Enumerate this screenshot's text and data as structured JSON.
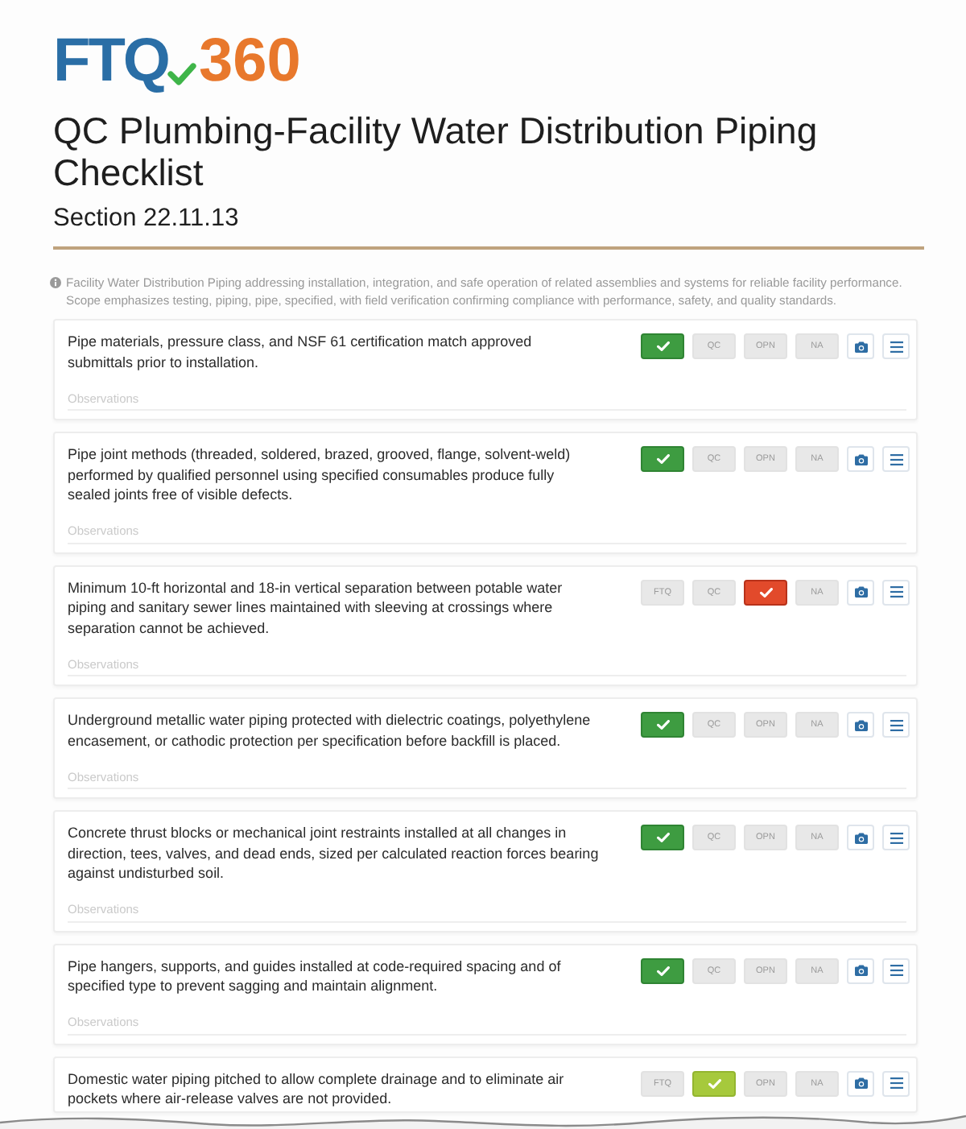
{
  "logo": {
    "wordmark": "FTQ",
    "number": "360"
  },
  "title": "QC Plumbing-Facility Water Distribution Piping Checklist",
  "section": "Section 22.11.13",
  "description": "Facility Water Distribution Piping addressing installation, integration, and safe operation of related assemblies and systems for reliable facility performance. Scope emphasizes testing, piping, pipe, specified, with field verification confirming compliance with performance, safety, and quality standards.",
  "items": [
    {
      "text": "Pipe materials, pressure class, and NSF 61 certification match approved submittals prior to installation.",
      "statuses": [
        {
          "selected": true
        },
        {
          "label": "QC",
          "selected": false
        },
        {
          "label": "OPN",
          "selected": false
        },
        {
          "label": "NA",
          "selected": false
        }
      ],
      "observations_placeholder": "Observations"
    },
    {
      "text": "Pipe joint methods (threaded, soldered, brazed, grooved, flange, solvent-weld) performed by qualified personnel using specified consumables produce fully sealed joints free of visible defects.",
      "statuses": [
        {
          "selected": true
        },
        {
          "label": "QC",
          "selected": false
        },
        {
          "label": "OPN",
          "selected": false
        },
        {
          "label": "NA",
          "selected": false
        }
      ],
      "observations_placeholder": "Observations"
    },
    {
      "text": "Minimum 10-ft horizontal and 18-in vertical separation between potable water piping and sanitary sewer lines maintained with sleeving at crossings where separation cannot be achieved.",
      "statuses": [
        {
          "label": "FTQ",
          "selected": false
        },
        {
          "label": "QC",
          "selected": false
        },
        {
          "selected": true
        },
        {
          "label": "NA",
          "selected": false
        }
      ],
      "observations_placeholder": "Observations"
    },
    {
      "text": "Underground metallic water piping protected with dielectric coatings, polyethylene encasement, or cathodic protection per specification before backfill is placed.",
      "statuses": [
        {
          "selected": true
        },
        {
          "label": "QC",
          "selected": false
        },
        {
          "label": "OPN",
          "selected": false
        },
        {
          "label": "NA",
          "selected": false
        }
      ],
      "observations_placeholder": "Observations"
    },
    {
      "text": "Concrete thrust blocks or mechanical joint restraints installed at all changes in direction, tees, valves, and dead ends, sized per calculated reaction forces bearing against undisturbed soil.",
      "statuses": [
        {
          "selected": true
        },
        {
          "label": "QC",
          "selected": false
        },
        {
          "label": "OPN",
          "selected": false
        },
        {
          "label": "NA",
          "selected": false
        }
      ],
      "observations_placeholder": "Observations"
    },
    {
      "text": "Pipe hangers, supports, and guides installed at code-required spacing and of specified type to prevent sagging and maintain alignment.",
      "statuses": [
        {
          "selected": true
        },
        {
          "label": "QC",
          "selected": false
        },
        {
          "label": "OPN",
          "selected": false
        },
        {
          "label": "NA",
          "selected": false
        }
      ],
      "observations_placeholder": "Observations"
    },
    {
      "text": "Domestic water piping pitched to allow complete drainage and to eliminate air pockets where air-release valves are not provided.",
      "statuses": [
        {
          "label": "FTQ",
          "selected": false
        },
        {
          "selected": true
        },
        {
          "label": "OPN",
          "selected": false
        },
        {
          "label": "NA",
          "selected": false
        }
      ]
    }
  ]
}
